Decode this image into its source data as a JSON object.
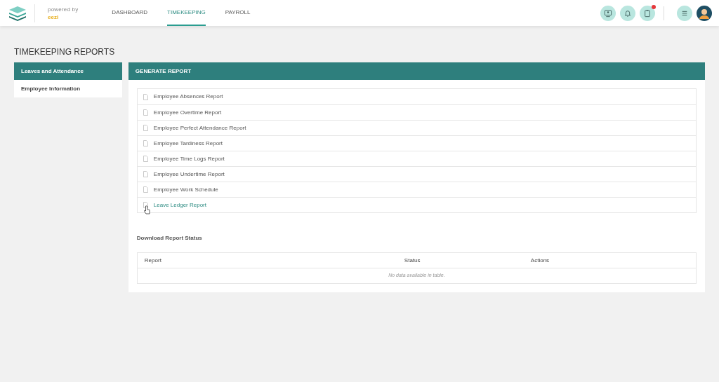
{
  "brand": {
    "powered_by": "powered by",
    "name": "eezi"
  },
  "nav_tabs": [
    {
      "label": "DASHBOARD",
      "selected": false
    },
    {
      "label": "TIMEKEEPING",
      "selected": true
    },
    {
      "label": "PAYROLL",
      "selected": false
    }
  ],
  "header_icons": [
    {
      "kind": "monitor",
      "alert": false
    },
    {
      "kind": "bell",
      "alert": false
    },
    {
      "kind": "clipboard",
      "alert": true
    },
    {
      "kind": "menu",
      "alert": false
    }
  ],
  "page_title": "TIMEKEEPING REPORTS",
  "sidebar": {
    "items": [
      {
        "label": "Leaves and Attendance",
        "selected": true
      },
      {
        "label": "Employee Information",
        "selected": false
      }
    ]
  },
  "panel_title": "GENERATE REPORT",
  "reports": [
    {
      "label": "Employee Absences Report",
      "hovered": false
    },
    {
      "label": "Employee Overtime Report",
      "hovered": false
    },
    {
      "label": "Employee Perfect Attendance Report",
      "hovered": false
    },
    {
      "label": "Employee Tardiness Report",
      "hovered": false
    },
    {
      "label": "Employee Time Logs Report",
      "hovered": false
    },
    {
      "label": "Employee Undertime Report",
      "hovered": false
    },
    {
      "label": "Employee Work Schedule",
      "hovered": false
    },
    {
      "label": "Leave Ledger Report",
      "hovered": true
    }
  ],
  "download_title": "Download Report Status",
  "table": {
    "columns": [
      "Report",
      "Status",
      "Actions"
    ],
    "empty_message": "No data available in table."
  }
}
